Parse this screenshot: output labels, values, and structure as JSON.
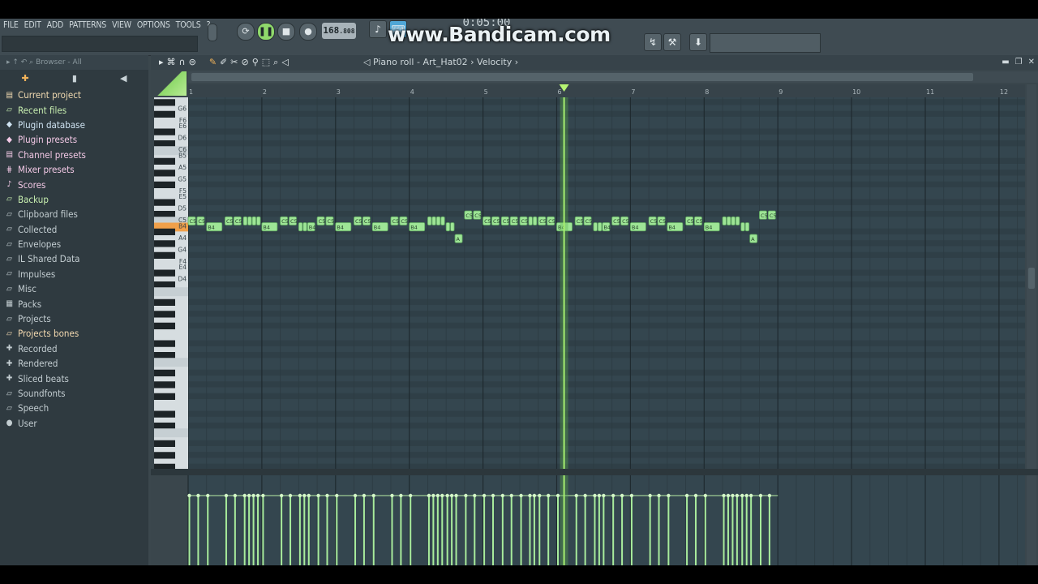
{
  "menu": [
    "FILE",
    "EDIT",
    "ADD",
    "PATTERNS",
    "VIEW",
    "OPTIONS",
    "TOOLS",
    "?"
  ],
  "tempo": {
    "value": "168",
    "decimal": ".808"
  },
  "time_display": "0:05:00",
  "watermark": "www.Bandicam.com",
  "browser": {
    "header": "Browser - All",
    "items": [
      {
        "label": "Current project",
        "color": "#f0d9b0",
        "icon": "page"
      },
      {
        "label": "Recent files",
        "color": "#c8efb0",
        "icon": "folder"
      },
      {
        "label": "Plugin database",
        "color": "#cfe3f2",
        "icon": "plug"
      },
      {
        "label": "Plugin presets",
        "color": "#f3c9e6",
        "icon": "plug"
      },
      {
        "label": "Channel presets",
        "color": "#f3c9e6",
        "icon": "page"
      },
      {
        "label": "Mixer presets",
        "color": "#f3c9e6",
        "icon": "mixer"
      },
      {
        "label": "Scores",
        "color": "#f3c9e6",
        "icon": "note"
      },
      {
        "label": "Backup",
        "color": "#c8efb0",
        "icon": "folder"
      },
      {
        "label": "Clipboard files",
        "color": "#c3cdd1",
        "icon": "folder"
      },
      {
        "label": "Collected",
        "color": "#c3cdd1",
        "icon": "folder"
      },
      {
        "label": "Envelopes",
        "color": "#c3cdd1",
        "icon": "folder"
      },
      {
        "label": "IL Shared Data",
        "color": "#c3cdd1",
        "icon": "folder"
      },
      {
        "label": "Impulses",
        "color": "#c3cdd1",
        "icon": "folder"
      },
      {
        "label": "Misc",
        "color": "#c3cdd1",
        "icon": "folder"
      },
      {
        "label": "Packs",
        "color": "#c3cdd1",
        "icon": "packs"
      },
      {
        "label": "Projects",
        "color": "#c3cdd1",
        "icon": "folder"
      },
      {
        "label": "Projects bones",
        "color": "#f3d9b0",
        "icon": "folder"
      },
      {
        "label": "Recorded",
        "color": "#c3cdd1",
        "icon": "plus"
      },
      {
        "label": "Rendered",
        "color": "#c3cdd1",
        "icon": "plus"
      },
      {
        "label": "Sliced beats",
        "color": "#c3cdd1",
        "icon": "plus"
      },
      {
        "label": "Soundfonts",
        "color": "#c3cdd1",
        "icon": "folder"
      },
      {
        "label": "Speech",
        "color": "#c3cdd1",
        "icon": "folder"
      },
      {
        "label": "User",
        "color": "#c3cdd1",
        "icon": "user"
      }
    ]
  },
  "piano_roll": {
    "title_parts": [
      "Piano roll",
      "Art_Hat02",
      "Velocity"
    ],
    "bar_numbers": [
      "1",
      "2",
      "3",
      "4",
      "5",
      "6",
      "7",
      "8",
      "9",
      "10",
      "11",
      "12"
    ],
    "playhead_bar": 6.1,
    "key_labels": [
      "G6",
      "F6",
      "E6",
      "D6",
      "C6",
      "B5",
      "A5",
      "G5",
      "F5",
      "E5",
      "D5",
      "C5",
      "B4",
      "A4",
      "G4",
      "F4",
      "E4",
      "D4"
    ],
    "highlighted_key": "B4",
    "notes": [
      {
        "bar": 1.0,
        "len": 0.11,
        "pitch": "C5",
        "label": "C5"
      },
      {
        "bar": 1.12,
        "len": 0.11,
        "pitch": "C5",
        "label": "C5"
      },
      {
        "bar": 1.25,
        "len": 0.22,
        "pitch": "B4",
        "label": "B4"
      },
      {
        "bar": 1.5,
        "len": 0.11,
        "pitch": "C5",
        "label": "C5"
      },
      {
        "bar": 1.62,
        "len": 0.11,
        "pitch": "C5",
        "label": "C5"
      },
      {
        "bar": 1.75,
        "len": 0.06,
        "pitch": "C5",
        "label": ""
      },
      {
        "bar": 1.81,
        "len": 0.06,
        "pitch": "C5",
        "label": ""
      },
      {
        "bar": 1.87,
        "len": 0.06,
        "pitch": "C5",
        "label": ""
      },
      {
        "bar": 1.93,
        "len": 0.06,
        "pitch": "C5",
        "label": ""
      },
      {
        "bar": 2.0,
        "len": 0.22,
        "pitch": "B4",
        "label": "B4"
      },
      {
        "bar": 2.25,
        "len": 0.11,
        "pitch": "C5",
        "label": "C5"
      },
      {
        "bar": 2.37,
        "len": 0.11,
        "pitch": "C5",
        "label": "C5"
      },
      {
        "bar": 2.5,
        "len": 0.06,
        "pitch": "B4",
        "label": ""
      },
      {
        "bar": 2.56,
        "len": 0.06,
        "pitch": "B4",
        "label": ""
      },
      {
        "bar": 2.62,
        "len": 0.11,
        "pitch": "B4",
        "label": "B4"
      },
      {
        "bar": 2.75,
        "len": 0.11,
        "pitch": "C5",
        "label": "C5"
      },
      {
        "bar": 2.87,
        "len": 0.11,
        "pitch": "C5",
        "label": "C5"
      },
      {
        "bar": 3.0,
        "len": 0.22,
        "pitch": "B4",
        "label": "B4"
      },
      {
        "bar": 3.25,
        "len": 0.11,
        "pitch": "C5",
        "label": "C5"
      },
      {
        "bar": 3.37,
        "len": 0.11,
        "pitch": "C5",
        "label": "C5"
      },
      {
        "bar": 3.5,
        "len": 0.22,
        "pitch": "B4",
        "label": "B4"
      },
      {
        "bar": 3.75,
        "len": 0.11,
        "pitch": "C5",
        "label": "C5"
      },
      {
        "bar": 3.87,
        "len": 0.11,
        "pitch": "C5",
        "label": "C5"
      },
      {
        "bar": 4.0,
        "len": 0.22,
        "pitch": "B4",
        "label": "B4"
      },
      {
        "bar": 4.25,
        "len": 0.06,
        "pitch": "C5",
        "label": ""
      },
      {
        "bar": 4.31,
        "len": 0.06,
        "pitch": "C5",
        "label": ""
      },
      {
        "bar": 4.37,
        "len": 0.06,
        "pitch": "C5",
        "label": ""
      },
      {
        "bar": 4.43,
        "len": 0.06,
        "pitch": "C5",
        "label": ""
      },
      {
        "bar": 4.5,
        "len": 0.06,
        "pitch": "B4",
        "label": ""
      },
      {
        "bar": 4.56,
        "len": 0.06,
        "pitch": "B4",
        "label": ""
      },
      {
        "bar": 4.62,
        "len": 0.11,
        "pitch": "A4",
        "label": "A"
      },
      {
        "bar": 4.75,
        "len": 0.11,
        "pitch": "C#5",
        "label": "C5"
      },
      {
        "bar": 4.87,
        "len": 0.11,
        "pitch": "C#5",
        "label": "C5"
      },
      {
        "bar": 5.0,
        "len": 0.11,
        "pitch": "C5",
        "label": "C5"
      },
      {
        "bar": 5.12,
        "len": 0.11,
        "pitch": "C5",
        "label": "C5"
      },
      {
        "bar": 5.25,
        "len": 0.11,
        "pitch": "C5",
        "label": "C5"
      },
      {
        "bar": 5.37,
        "len": 0.11,
        "pitch": "C5",
        "label": "C5"
      },
      {
        "bar": 5.5,
        "len": 0.11,
        "pitch": "C5",
        "label": "C5"
      },
      {
        "bar": 5.62,
        "len": 0.06,
        "pitch": "C5",
        "label": ""
      },
      {
        "bar": 5.68,
        "len": 0.06,
        "pitch": "C5",
        "label": ""
      },
      {
        "bar": 5.75,
        "len": 0.11,
        "pitch": "C5",
        "label": "C5"
      },
      {
        "bar": 5.87,
        "len": 0.11,
        "pitch": "C5",
        "label": "C5"
      },
      {
        "bar": 6.0,
        "len": 0.22,
        "pitch": "B4",
        "label": "B4"
      },
      {
        "bar": 6.25,
        "len": 0.11,
        "pitch": "C5",
        "label": "C5"
      },
      {
        "bar": 6.37,
        "len": 0.11,
        "pitch": "C5",
        "label": "C5"
      },
      {
        "bar": 6.5,
        "len": 0.06,
        "pitch": "B4",
        "label": ""
      },
      {
        "bar": 6.56,
        "len": 0.06,
        "pitch": "B4",
        "label": ""
      },
      {
        "bar": 6.62,
        "len": 0.11,
        "pitch": "B4",
        "label": "B4"
      },
      {
        "bar": 6.75,
        "len": 0.11,
        "pitch": "C5",
        "label": "C5"
      },
      {
        "bar": 6.87,
        "len": 0.11,
        "pitch": "C5",
        "label": "C5"
      },
      {
        "bar": 7.0,
        "len": 0.22,
        "pitch": "B4",
        "label": "B4"
      },
      {
        "bar": 7.25,
        "len": 0.11,
        "pitch": "C5",
        "label": "C5"
      },
      {
        "bar": 7.37,
        "len": 0.11,
        "pitch": "C5",
        "label": "C5"
      },
      {
        "bar": 7.5,
        "len": 0.22,
        "pitch": "B4",
        "label": "B4"
      },
      {
        "bar": 7.75,
        "len": 0.11,
        "pitch": "C5",
        "label": "C5"
      },
      {
        "bar": 7.87,
        "len": 0.11,
        "pitch": "C5",
        "label": "C5"
      },
      {
        "bar": 8.0,
        "len": 0.22,
        "pitch": "B4",
        "label": "B4"
      },
      {
        "bar": 8.25,
        "len": 0.06,
        "pitch": "C5",
        "label": ""
      },
      {
        "bar": 8.31,
        "len": 0.06,
        "pitch": "C5",
        "label": ""
      },
      {
        "bar": 8.37,
        "len": 0.06,
        "pitch": "C5",
        "label": ""
      },
      {
        "bar": 8.43,
        "len": 0.06,
        "pitch": "C5",
        "label": ""
      },
      {
        "bar": 8.5,
        "len": 0.06,
        "pitch": "B4",
        "label": ""
      },
      {
        "bar": 8.56,
        "len": 0.06,
        "pitch": "B4",
        "label": ""
      },
      {
        "bar": 8.62,
        "len": 0.11,
        "pitch": "A4",
        "label": "A"
      },
      {
        "bar": 8.75,
        "len": 0.11,
        "pitch": "C#5",
        "label": "C5"
      },
      {
        "bar": 8.87,
        "len": 0.11,
        "pitch": "C#5",
        "label": "C5"
      }
    ]
  }
}
